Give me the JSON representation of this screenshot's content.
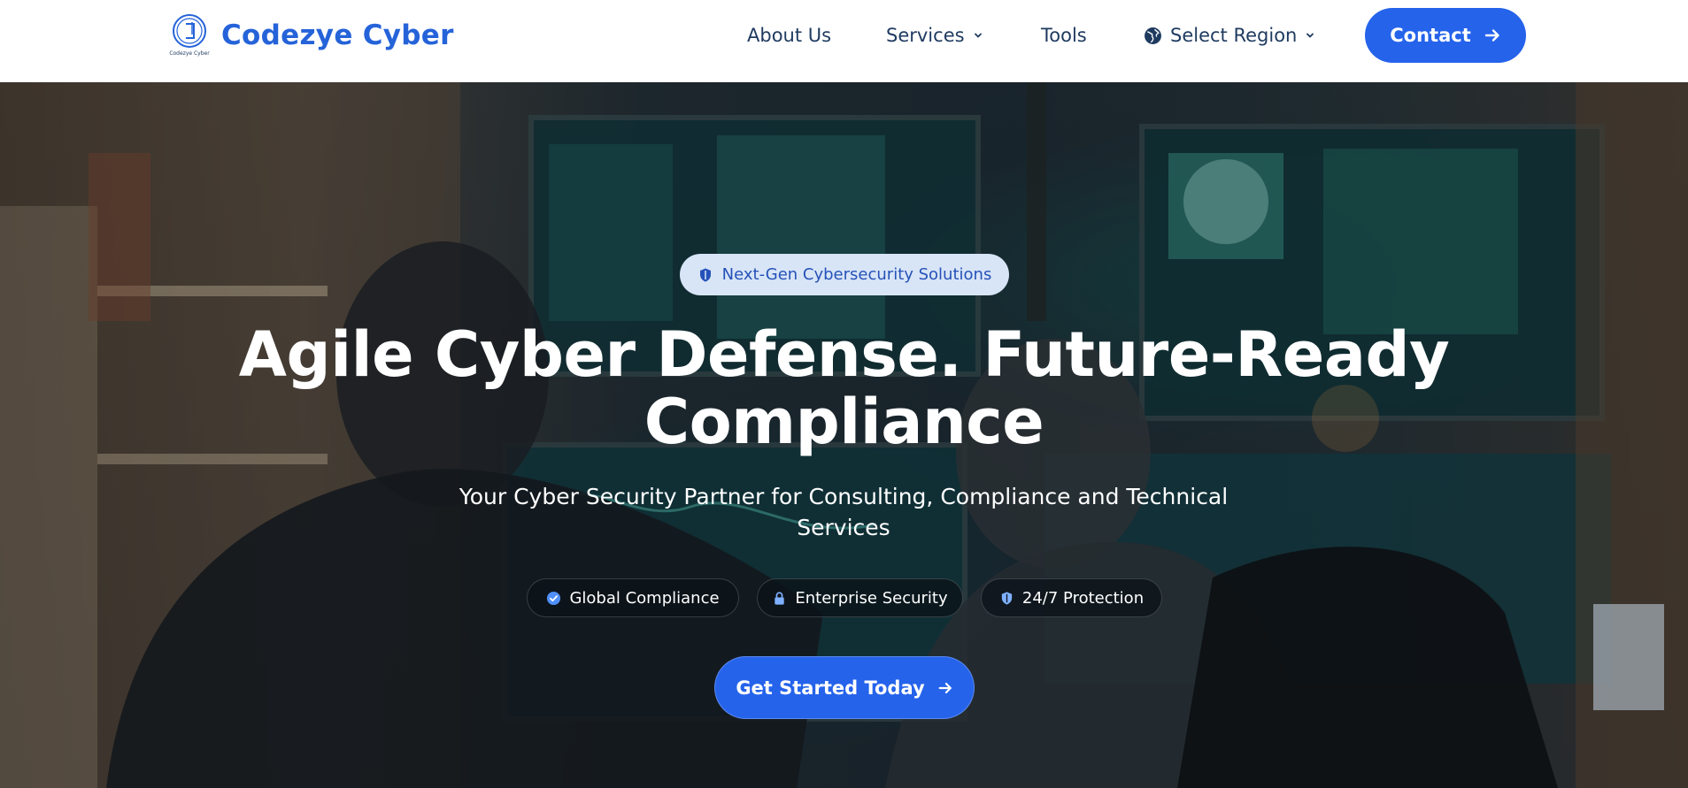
{
  "brand": {
    "name": "Codezye Cyber",
    "logo_caption": "Codezye Cyber",
    "accent": "#2563eb"
  },
  "nav": {
    "about": "About Us",
    "services": "Services",
    "tools": "Tools",
    "region": "Select Region",
    "contact": "Contact"
  },
  "hero": {
    "badge": "Next-Gen Cybersecurity Solutions",
    "headline_line1": "Agile Cyber Defense. Future-Ready",
    "headline_line2": "Compliance",
    "subtitle": "Your Cyber Security Partner for Consulting, Compliance and Technical Services",
    "features": [
      {
        "label": "Global Compliance",
        "icon": "check-circle-icon"
      },
      {
        "label": "Enterprise Security",
        "icon": "lock-icon"
      },
      {
        "label": "24/7 Protection",
        "icon": "shield-icon"
      }
    ],
    "cta": "Get Started Today"
  },
  "icons": {
    "services_chevron": "chevron-down-icon",
    "region_chevron": "chevron-down-icon",
    "region_icon": "globe-icon",
    "contact_icon": "arrow-right-icon",
    "cta_icon": "arrow-right-icon",
    "badge_icon": "shield-icon"
  }
}
